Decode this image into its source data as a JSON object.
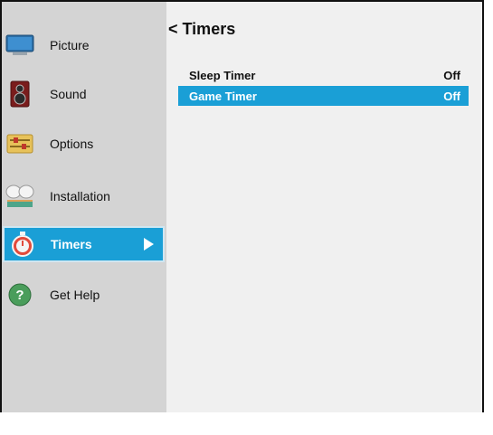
{
  "sidebar": {
    "items": [
      {
        "label": "Picture",
        "icon": "monitor-icon"
      },
      {
        "label": "Sound",
        "icon": "speaker-icon"
      },
      {
        "label": "Options",
        "icon": "sliders-icon"
      },
      {
        "label": "Installation",
        "icon": "satellite-icon"
      },
      {
        "label": "Timers",
        "icon": "stopwatch-icon",
        "active": true
      },
      {
        "label": "Get Help",
        "icon": "help-icon"
      }
    ]
  },
  "main": {
    "title": "< Timers",
    "rows": [
      {
        "label": "Sleep Timer",
        "value": "Off"
      },
      {
        "label": "Game Timer",
        "value": "Off",
        "selected": true
      }
    ]
  },
  "colors": {
    "accent": "#1a9fd6",
    "sidebar_bg": "#d4d4d4",
    "panel_bg": "#f0f0f0"
  }
}
